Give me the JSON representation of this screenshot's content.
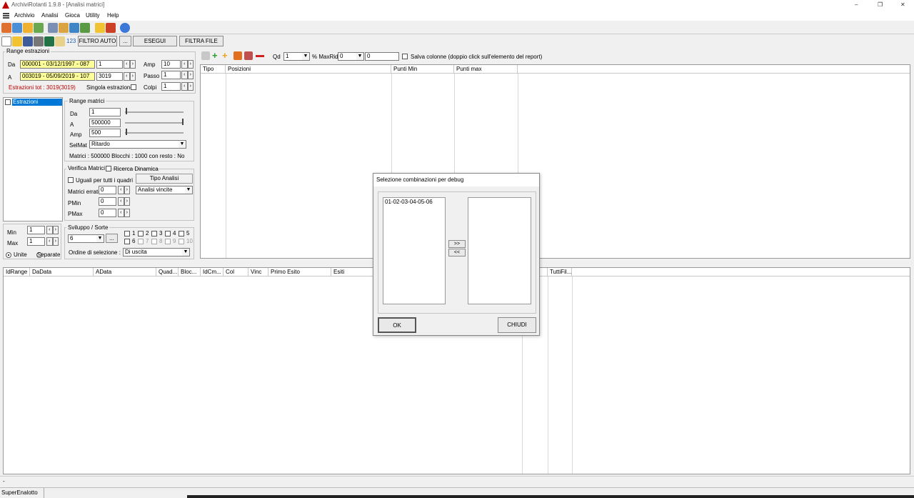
{
  "window": {
    "title": "ArchiviRotanti  1.9.8 - [Analisi matrici]",
    "controls": {
      "minimize": "–",
      "restore": "❐",
      "close": "✕"
    }
  },
  "menu": {
    "items": [
      "Archivio",
      "Analisi",
      "Gioca",
      "Utility",
      "Help"
    ]
  },
  "toolbar2": {
    "label_123": "123",
    "filtro_auto": "FILTRO AUTO",
    "dots": "...",
    "esegui": "ESEGUI",
    "filtra_file": "FILTRA FILE"
  },
  "range_estrazioni": {
    "title": "Range estrazioni",
    "da_label": "Da",
    "da_value": "000001 - 03/12/1997 - 087",
    "da_num": "1",
    "a_label": "A",
    "a_value": "003019 - 05/09/2019 - 107",
    "a_num": "3019",
    "amp_label": "Amp",
    "amp_value": "10",
    "passo_label": "Passo",
    "passo_value": "1",
    "colpi_label": "Colpi",
    "colpi_value": "1",
    "estrazioni_tot": "Estrazioni tot : 3019(3019)",
    "singola_label": "Singola estrazione"
  },
  "tree": {
    "item": "Estrazioni"
  },
  "range_matrici": {
    "title": "Range matrici",
    "da_label": "Da",
    "da_value": "1",
    "a_label": "A",
    "a_value": "500000",
    "amp_label": "Amp",
    "amp_value": "500",
    "selmat_label": "SelMat",
    "selmat_value": "Ritardo",
    "info": "Matrici : 500000 Blocchi : 1000 con resto : No"
  },
  "verifica": {
    "title": "Verifica Matrici",
    "ricerca_label": "Ricerca Dinamica",
    "uguali_label": "Uguali per tutti i quadri",
    "tipo_analisi_label": "Tipo Analisi",
    "tipo_analisi_value": "Analisi vincite",
    "matrici_errate_label": "Matrici errate",
    "matrici_errate_value": "0",
    "pmin_label": "PMin",
    "pmin_value": "0",
    "pmax_label": "PMax",
    "pmax_value": "0"
  },
  "minmax": {
    "min_label": "Min",
    "min_value": "1",
    "max_label": "Max",
    "max_value": "1",
    "unite_label": "Unite",
    "separate_label": "Separate"
  },
  "sviluppo": {
    "title": "Sviluppo / Sorte",
    "value": "6",
    "dots": "...",
    "checks": [
      "1",
      "2",
      "3",
      "4",
      "5",
      "6",
      "7",
      "8",
      "9",
      "10"
    ],
    "ordine_label": "Ordine di selezione :",
    "ordine_value": "Di uscita"
  },
  "report_toolbar": {
    "qd_label": "Qd",
    "qd_value": "1",
    "maxrid_label": "% MaxRid",
    "maxrid_value": "0",
    "maxrid_num": "0",
    "salva_label": "Salva colonne (doppio click sull'elemento del report)"
  },
  "top_table": {
    "columns": [
      "Tipo",
      "Posizioni",
      "Punti Min",
      "Punti max"
    ]
  },
  "bottom_table": {
    "columns": [
      "IdRange",
      "DaData",
      "AData",
      "Quad...",
      "Bloc...",
      "IdCm...",
      "Col",
      "Vinc",
      "Primo Esito",
      "Esiti",
      "TuttiFil..."
    ]
  },
  "dialog": {
    "title": "Selezione combinazioni per debug",
    "left_items": [
      "01-02-03-04-05-06"
    ],
    "right_items": [],
    "move_right": ">>",
    "move_left": "<<",
    "ok": "OK",
    "chiudi": "CHIUDI"
  },
  "status": {
    "line": "-",
    "panel": "SuperEnalotto"
  },
  "colors": {
    "selection": "#0078d7",
    "highlight_field": "#ffff99",
    "error_text": "#c00000"
  }
}
